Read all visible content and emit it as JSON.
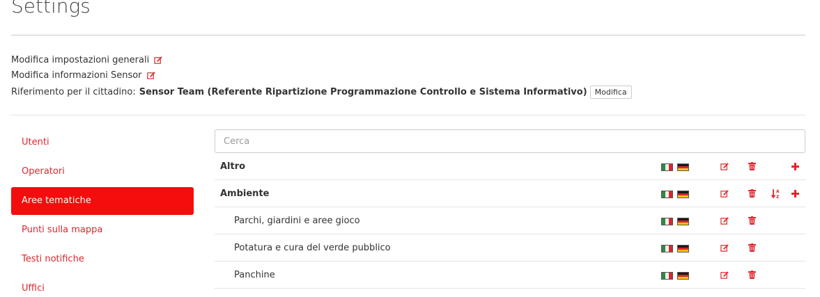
{
  "page": {
    "title": "Settings"
  },
  "info": {
    "general_link": "Modifica impostazioni generali",
    "sensor_link": "Modifica informazioni Sensor",
    "reference_label": "Riferimento per il cittadino:",
    "reference_value": "Sensor Team (Referente Ripartizione Programmazione Controllo e Sistema Informativo)",
    "modify_button": "Modifica"
  },
  "nav": {
    "items": [
      {
        "label": "Utenti",
        "active": false
      },
      {
        "label": "Operatori",
        "active": false
      },
      {
        "label": "Aree tematiche",
        "active": true
      },
      {
        "label": "Punti sulla mappa",
        "active": false
      },
      {
        "label": "Testi notifiche",
        "active": false
      },
      {
        "label": "Uffici",
        "active": false
      }
    ]
  },
  "search": {
    "placeholder": "Cerca",
    "value": ""
  },
  "rows": [
    {
      "name": "Altro",
      "level": "parent",
      "sort": false,
      "add": true
    },
    {
      "name": "Ambiente",
      "level": "parent",
      "sort": true,
      "add": true
    },
    {
      "name": "Parchi, giardini e aree gioco",
      "level": "child",
      "sort": false,
      "add": false
    },
    {
      "name": "Potatura e cura del verde pubblico",
      "level": "child",
      "sort": false,
      "add": false
    },
    {
      "name": "Panchine",
      "level": "child",
      "sort": false,
      "add": false
    }
  ],
  "icons": {
    "edit": "edit-icon",
    "delete": "trash-icon",
    "sort": "sort-alpha-icon",
    "add": "plus-icon",
    "flag_it": "italian-flag-icon",
    "flag_de": "german-flag-icon"
  },
  "colors": {
    "accent": "#f50c0c",
    "link": "#e0262d",
    "divider": "#e4e4e4"
  }
}
